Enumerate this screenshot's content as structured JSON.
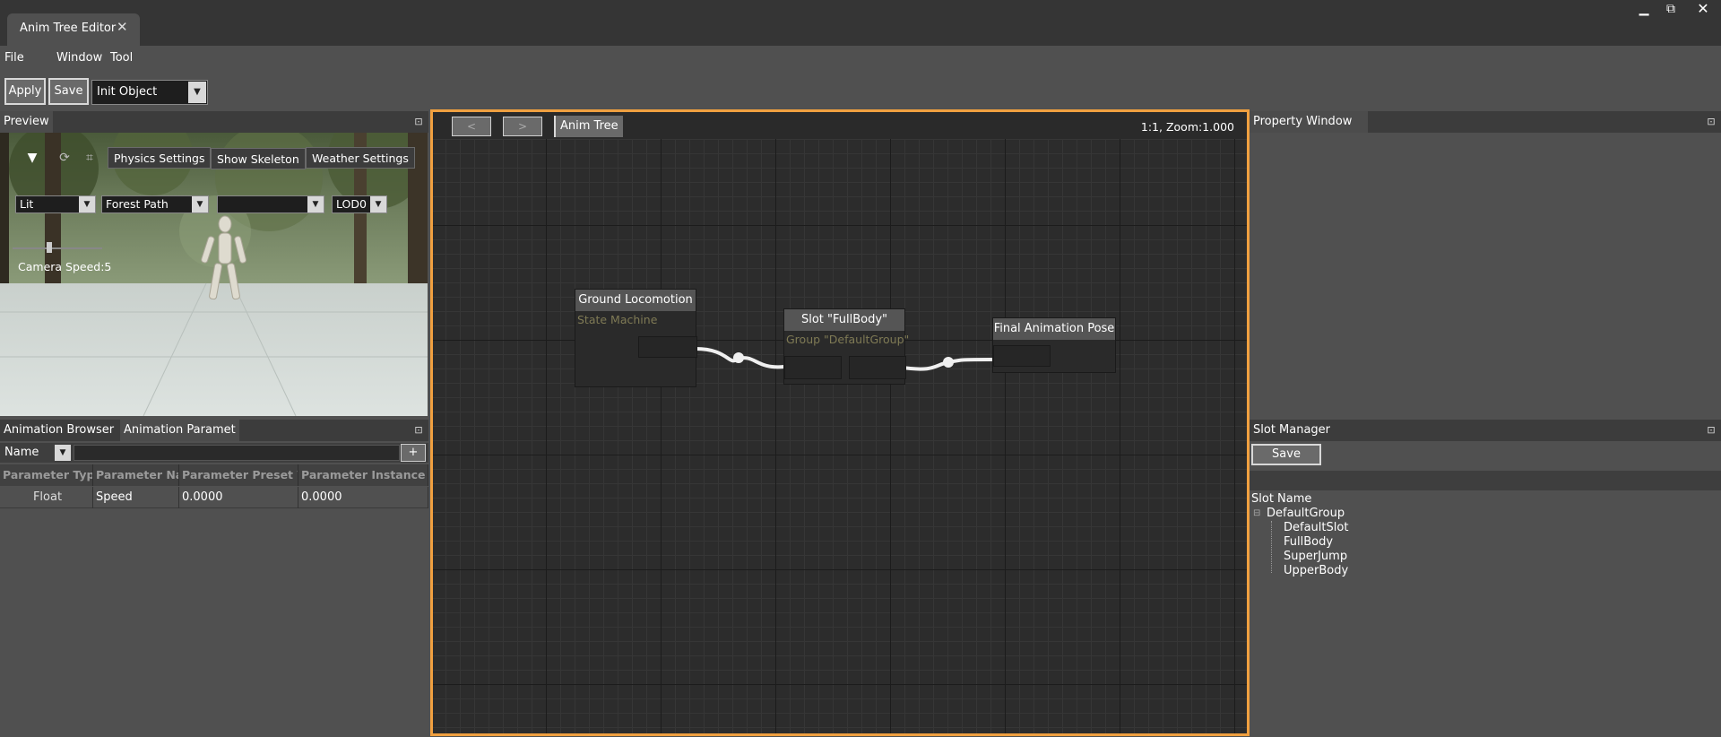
{
  "window": {
    "tab_title": "Anim Tree Editor",
    "tab_close": "✕",
    "controls": {
      "minimize": "▁",
      "restore": "⧉",
      "close": "✕"
    }
  },
  "menu": {
    "file": "File",
    "window": "Window",
    "tool": "Tool"
  },
  "toolbar": {
    "apply_label": "Apply",
    "save_label": "Save",
    "object_select": "Init Object"
  },
  "preview": {
    "tab": "Preview",
    "physics_settings": "Physics Settings",
    "show_skeleton": "Show Skeleton",
    "weather_settings": "Weather Settings",
    "lighting_mode": "Lit",
    "environment": "Forest Path",
    "third_select": "",
    "lod": "LOD0",
    "camera_speed": "Camera Speed:5"
  },
  "animation_panel": {
    "tabs": [
      "Animation Browser",
      "Animation Paramet"
    ],
    "filter_label": "Name",
    "add_button": "+",
    "columns": [
      "Parameter Type",
      "Parameter Name",
      "Parameter Preset Value",
      "Parameter Instance Value"
    ],
    "rows": [
      {
        "type": "Float",
        "name": "Speed",
        "preset": "0.0000",
        "instance": "0.0000"
      }
    ]
  },
  "graph": {
    "breadcrumb": "Anim Tree",
    "back_button": "<",
    "forward_button": ">",
    "zoom_readout": "1:1, Zoom:1.000",
    "nodes": {
      "ground_locomotion": {
        "title": "Ground Locomotion",
        "subtitle": "State Machine"
      },
      "slot": {
        "title": "Slot \"FullBody\"",
        "subtitle": "Group \"DefaultGroup\""
      },
      "final_pose": {
        "title": "Final Animation Pose",
        "subtitle": ""
      }
    }
  },
  "property_window": {
    "tab": "Property Window"
  },
  "slot_manager": {
    "tab": "Slot Manager",
    "save_label": "Save",
    "column_header": "Slot Name",
    "group": "DefaultGroup",
    "slots": [
      "DefaultSlot",
      "FullBody",
      "SuperJump",
      "UpperBody"
    ]
  },
  "colors": {
    "accent_frame": "#f0a040",
    "background": "#505050",
    "panel_header": "#3c3c3c"
  }
}
